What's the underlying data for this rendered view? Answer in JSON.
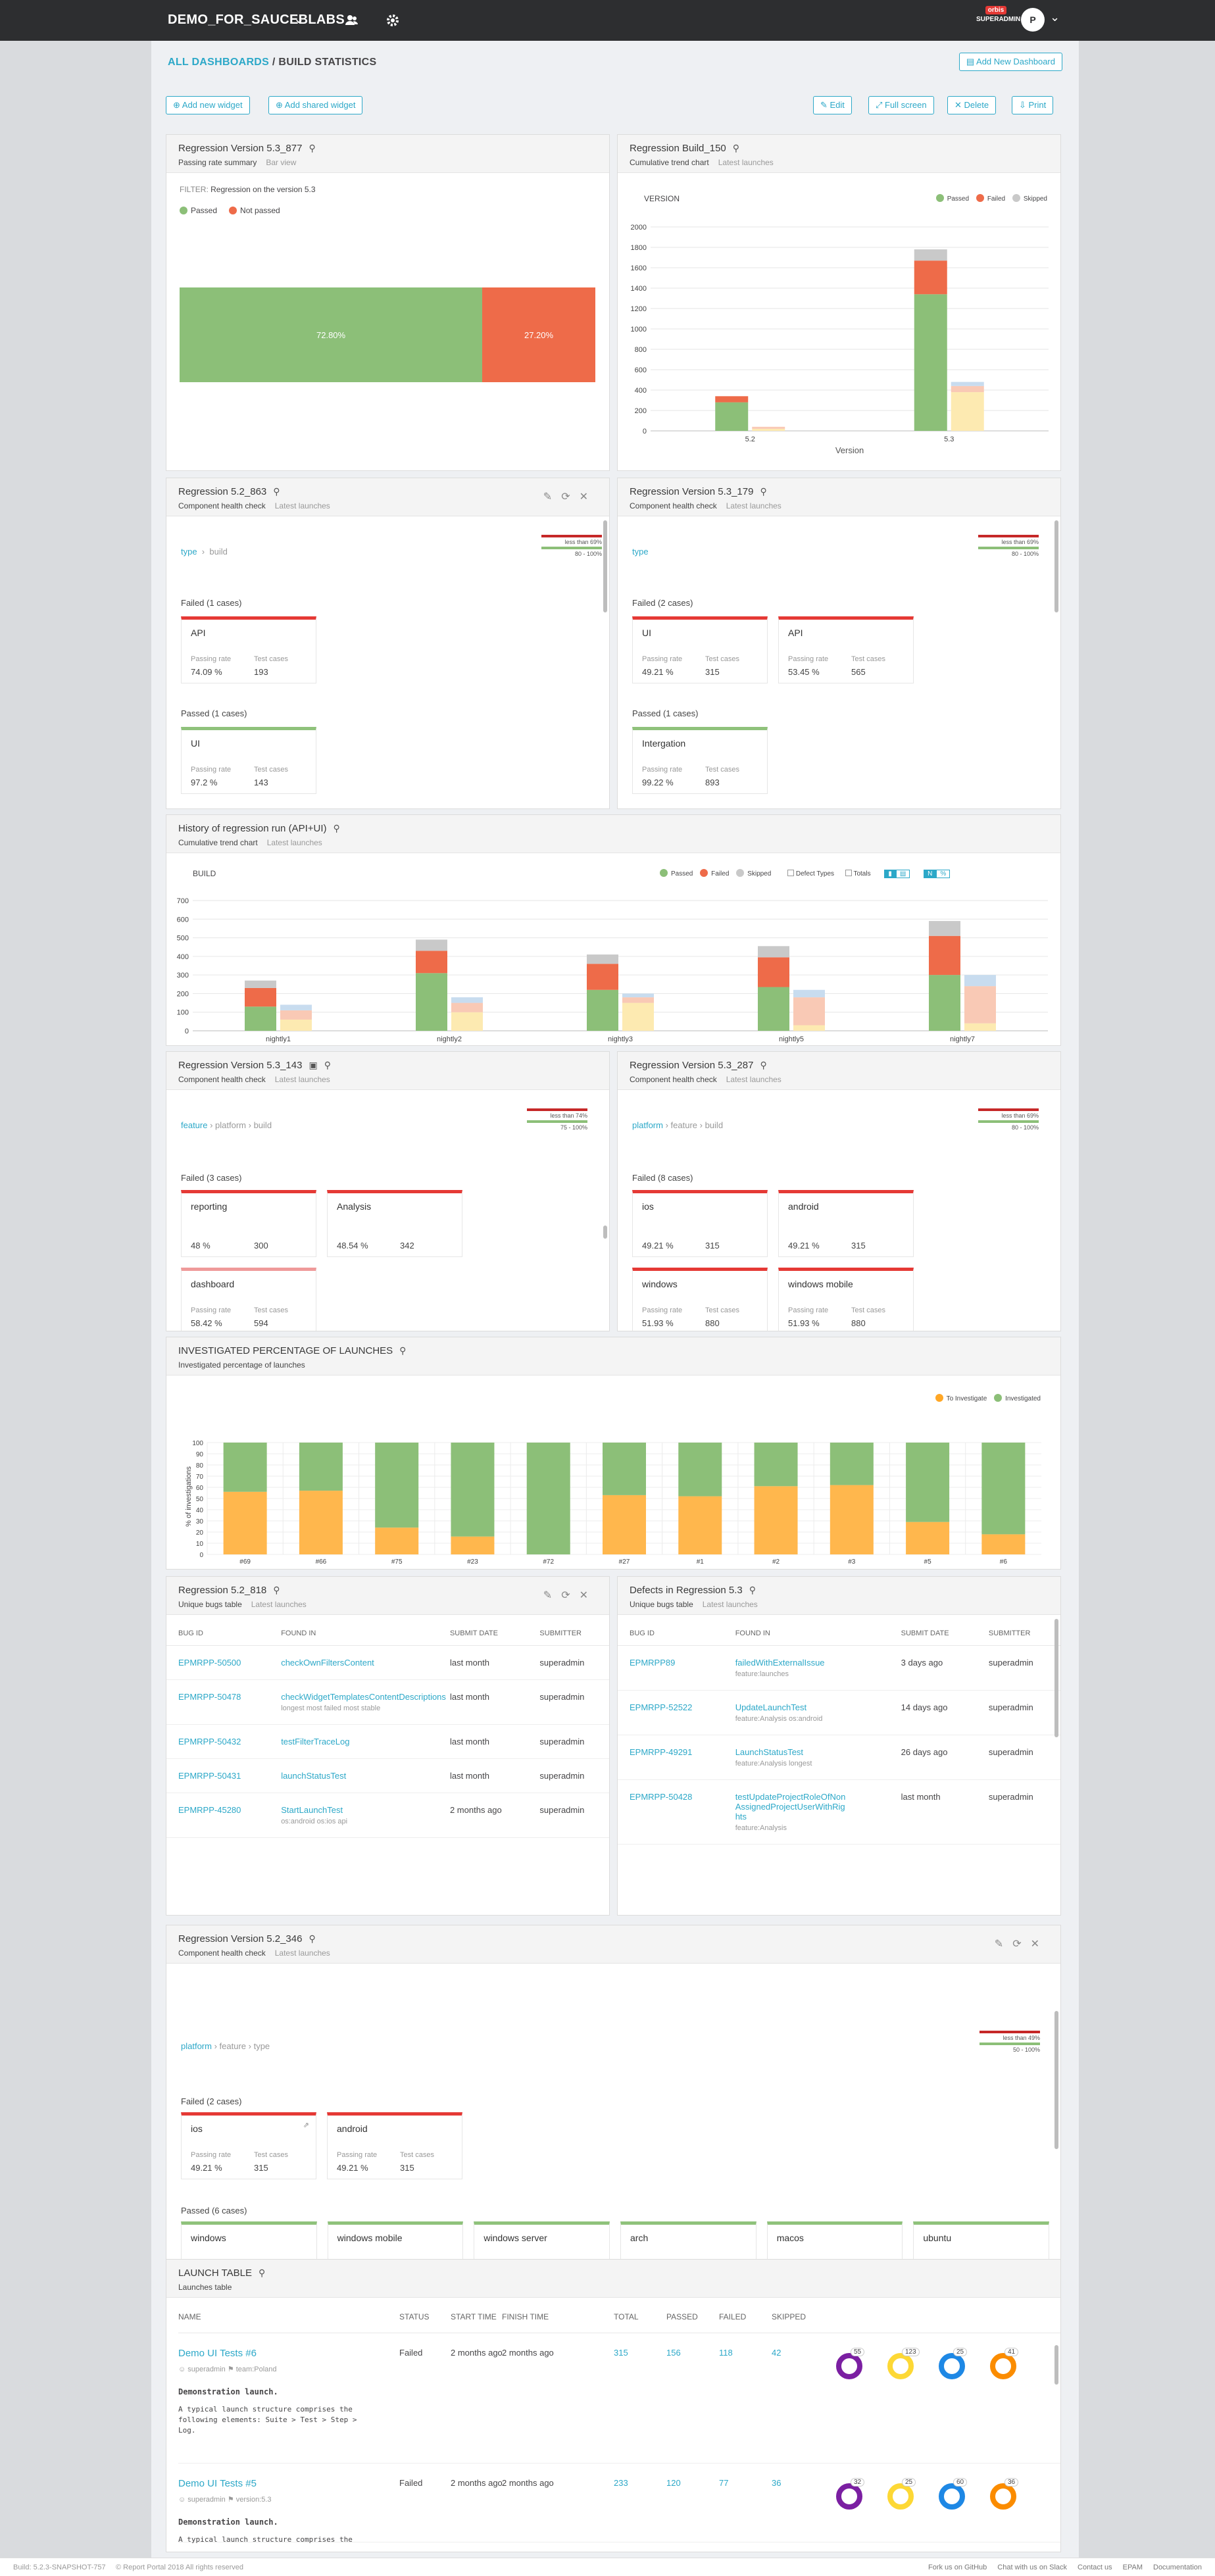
{
  "topbar": {
    "project": "DEMO_FOR_SAUCEBLABS",
    "org_badge": "orbis",
    "org_name": "SUPERADMIN",
    "avatar": "P"
  },
  "breadcrumb": {
    "root": "ALL DASHBOARDS",
    "sep": " / ",
    "current": "BUILD STATISTICS"
  },
  "actions": {
    "add_dashboard": "Add New Dashboard",
    "add_widget": "Add new widget",
    "add_shared": "Add shared widget",
    "edit": "Edit",
    "full_screen": "Full screen",
    "delete": "Delete",
    "print": "Print"
  },
  "w1": {
    "title": "Regression Version 5.3_877",
    "sub": "Passing rate summary",
    "sub2": "Bar view",
    "filter_label": "FILTER:",
    "filter_value": "Regression on the version 5.3",
    "legend": [
      "Passed",
      "Not passed"
    ],
    "passed_pct": "72.80%",
    "not_passed_pct": "27.20%"
  },
  "w2": {
    "title": "Regression Build_150",
    "sub": "Cumulative trend chart",
    "sub2": "Latest launches",
    "label": "VERSION",
    "xlabel": "Version",
    "legend": [
      "Passed",
      "Failed",
      "Skipped"
    ]
  },
  "w3": {
    "title": "Regression 5.2_863",
    "sub": "Component health check",
    "sub2": "Latest launches",
    "crumb": [
      "type",
      "build"
    ],
    "legend_top": "less than 69%",
    "legend_bottom": "80 - 100%",
    "failed_title": "Failed (1 cases)",
    "passed_title": "Passed (1 cases)",
    "metric_a": "Passing rate",
    "metric_b": "Test cases",
    "failed": [
      {
        "name": "API",
        "rate": "74.09 %",
        "cases": "193"
      }
    ],
    "passed": [
      {
        "name": "UI",
        "rate": "97.2 %",
        "cases": "143"
      }
    ]
  },
  "w4": {
    "title": "Regression Version 5.3_179",
    "sub": "Component health check",
    "sub2": "Latest launches",
    "crumb": [
      "type"
    ],
    "legend_top": "less than 69%",
    "legend_bottom": "80 - 100%",
    "failed_title": "Failed (2 cases)",
    "passed_title": "Passed (1 cases)",
    "metric_a": "Passing rate",
    "metric_b": "Test cases",
    "failed": [
      {
        "name": "UI",
        "rate": "49.21 %",
        "cases": "315"
      },
      {
        "name": "API",
        "rate": "53.45 %",
        "cases": "565"
      }
    ],
    "passed": [
      {
        "name": "Intergation",
        "rate": "99.22 %",
        "cases": "893"
      }
    ]
  },
  "w5": {
    "title": "History of regression run (API+UI)",
    "sub": "Cumulative trend chart",
    "sub2": "Latest launches",
    "label": "BUILD",
    "xlabel": "Build",
    "legend": [
      "Passed",
      "Failed",
      "Skipped"
    ],
    "opt1": "Defect Types",
    "opt2": "Totals",
    "toggle_n": "N",
    "toggle_pct": "%"
  },
  "w6": {
    "title": "Regression Version 5.3_143",
    "sub": "Component health check",
    "sub2": "Latest launches",
    "crumb": [
      "feature",
      "platform",
      "build"
    ],
    "legend_top": "less than 74%",
    "legend_bottom": "75 - 100%",
    "failed_title": "Failed (3 cases)",
    "metric_a": "Passing rate",
    "metric_b": "Test cases",
    "failed": [
      {
        "name": "reporting",
        "rate": "48 %",
        "cases": "300"
      },
      {
        "name": "Analysis",
        "rate": "48.54 %",
        "cases": "342"
      },
      {
        "name": "dashboard",
        "rate": "58.42 %",
        "cases": "594"
      }
    ]
  },
  "w7": {
    "title": "Regression Version 5.3_287",
    "sub": "Component health check",
    "sub2": "Latest launches",
    "crumb": [
      "platform",
      "feature",
      "build"
    ],
    "legend_top": "less than 69%",
    "legend_bottom": "80 - 100%",
    "failed_title": "Failed (8 cases)",
    "metric_a": "Passing rate",
    "metric_b": "Test cases",
    "failed": [
      {
        "name": "ios",
        "rate": "49.21 %",
        "cases": "315"
      },
      {
        "name": "android",
        "rate": "49.21 %",
        "cases": "315"
      },
      {
        "name": "windows",
        "rate": "51.93 %",
        "cases": "880"
      },
      {
        "name": "windows mobile",
        "rate": "51.93 %",
        "cases": "880"
      }
    ]
  },
  "w8": {
    "title": "INVESTIGATED PERCENTAGE OF LAUNCHES",
    "sub": "Investigated percentage of launches",
    "legend": [
      "To Investigate",
      "Investigated"
    ],
    "ylabel": "% of investigations"
  },
  "w9": {
    "title": "Regression 5.2_818",
    "sub": "Unique bugs table",
    "sub2": "Latest launches",
    "cols": [
      "BUG ID",
      "FOUND IN",
      "SUBMIT DATE",
      "SUBMITTER"
    ],
    "rows": [
      {
        "id": "EPMRPP-50500",
        "found": "checkOwnFiltersContent",
        "tags": "",
        "date": "last month",
        "by": "superadmin"
      },
      {
        "id": "EPMRPP-50478",
        "found": "checkWidgetTemplatesContentDescriptions",
        "tags": "longest  most failed  most stable",
        "date": "last month",
        "by": "superadmin"
      },
      {
        "id": "EPMRPP-50432",
        "found": "testFilterTraceLog",
        "tags": "",
        "date": "last month",
        "by": "superadmin"
      },
      {
        "id": "EPMRPP-50431",
        "found": "launchStatusTest",
        "tags": "",
        "date": "last month",
        "by": "superadmin"
      },
      {
        "id": "EPMRPP-45280",
        "found": "StartLaunchTest",
        "tags": "os:android  os:ios  api",
        "date": "2 months ago",
        "by": "superadmin"
      }
    ]
  },
  "w10": {
    "title": "Defects in Regression 5.3",
    "sub": "Unique bugs table",
    "sub2": "Latest launches",
    "cols": [
      "BUG ID",
      "FOUND IN",
      "SUBMIT DATE",
      "SUBMITTER"
    ],
    "rows": [
      {
        "id": "EPMRPP89",
        "found": "failedWithExternalIssue",
        "tags": "feature:launches",
        "date": "3 days ago",
        "by": "superadmin"
      },
      {
        "id": "EPMRPP-52522",
        "found": "UpdateLaunchTest",
        "tags": "feature:Analysis  os:android",
        "date": "14 days ago",
        "by": "superadmin"
      },
      {
        "id": "EPMRPP-49291",
        "found": "LaunchStatusTest",
        "tags": "feature:Analysis  longest",
        "date": "26 days ago",
        "by": "superadmin"
      },
      {
        "id": "EPMRPP-50428",
        "found": "testUpdateProjectRoleOfNonAssignedProjectUserWithRights",
        "tags": "feature:Analysis",
        "date": "last month",
        "by": "superadmin"
      }
    ]
  },
  "w11": {
    "title": "Regression Version 5.2_346",
    "sub": "Component health check",
    "sub2": "Latest launches",
    "crumb": [
      "platform",
      "feature",
      "type"
    ],
    "legend_top": "less than 49%",
    "legend_bottom": "50 - 100%",
    "failed_title": "Failed (2 cases)",
    "passed_title": "Passed (6 cases)",
    "metric_a": "Passing rate",
    "metric_b": "Test cases",
    "failed": [
      {
        "name": "ios",
        "rate": "49.21 %",
        "cases": "315"
      },
      {
        "name": "android",
        "rate": "49.21 %",
        "cases": "315"
      }
    ],
    "passed": [
      "windows",
      "windows mobile",
      "windows server",
      "arch",
      "macos",
      "ubuntu"
    ]
  },
  "w12": {
    "title": "LAUNCH TABLE",
    "sub": "Launches table",
    "cols": [
      "NAME",
      "STATUS",
      "START TIME",
      "FINISH TIME",
      "TOTAL",
      "PASSED",
      "FAILED",
      "SKIPPED"
    ],
    "rows": [
      {
        "name": "Demo UI Tests #6",
        "owner": "superadmin",
        "attr": "team:Poland",
        "status": "Failed",
        "start": "2 months ago",
        "finish": "2 months ago",
        "total": "315",
        "passed": "156",
        "failed": "118",
        "skipped": "42",
        "desc_title": "Demonstration launch.",
        "desc": "A typical launch structure comprises the following elements: Suite > Test > Step > Log.",
        "badges": [
          "55",
          "123",
          "25",
          "41"
        ]
      },
      {
        "name": "Demo UI Tests #5",
        "owner": "superadmin",
        "attr": "version:5.3",
        "status": "Failed",
        "start": "2 months ago",
        "finish": "2 months ago",
        "total": "233",
        "passed": "120",
        "failed": "77",
        "skipped": "36",
        "desc_title": "Demonstration launch.",
        "desc": "A typical launch structure comprises the",
        "badges": [
          "32",
          "25",
          "60",
          "36"
        ]
      }
    ]
  },
  "footer": {
    "build": "Build: 5.2.3-SNAPSHOT-757",
    "copy": "© Report Portal 2018 All rights reserved",
    "links": [
      "Fork us on GitHub",
      "Chat with us on Slack",
      "Contact us",
      "EPAM",
      "Documentation"
    ]
  },
  "chart_data": [
    {
      "type": "bar",
      "title": "Regression Version 5.3_877",
      "categories": [
        "Regression on the version 5.3"
      ],
      "series": [
        {
          "name": "Passed",
          "values": [
            72.8
          ]
        },
        {
          "name": "Not passed",
          "values": [
            27.2
          ]
        }
      ]
    },
    {
      "type": "bar",
      "title": "Regression Build_150",
      "xlabel": "Version",
      "categories": [
        "5.2",
        "5.3"
      ],
      "ylim": [
        0,
        2000
      ],
      "yticks": [
        0,
        200,
        400,
        600,
        800,
        1000,
        1200,
        1400,
        1600,
        1800,
        2000
      ],
      "series": [
        {
          "name": "Passed",
          "values": [
            280,
            1340
          ]
        },
        {
          "name": "Failed",
          "values": [
            60,
            330
          ]
        },
        {
          "name": "Skipped",
          "values": [
            0,
            110
          ]
        }
      ],
      "prev_series": [
        {
          "name": "Passed",
          "values": [
            20,
            380
          ]
        },
        {
          "name": "Failed",
          "values": [
            20,
            60
          ]
        },
        {
          "name": "Skipped",
          "values": [
            0,
            40
          ]
        }
      ]
    },
    {
      "type": "bar",
      "title": "History of regression run (API+UI)",
      "xlabel": "Build",
      "categories": [
        "nightly1",
        "nightly2",
        "nightly3",
        "nightly5",
        "nightly7"
      ],
      "ylim": [
        0,
        700
      ],
      "yticks": [
        0,
        100,
        200,
        300,
        400,
        500,
        600,
        700
      ],
      "series": [
        {
          "name": "Passed",
          "values": [
            130,
            310,
            220,
            235,
            300
          ]
        },
        {
          "name": "Failed",
          "values": [
            100,
            120,
            140,
            160,
            210
          ]
        },
        {
          "name": "Skipped",
          "values": [
            40,
            60,
            50,
            60,
            80
          ]
        }
      ],
      "prev_series": [
        {
          "name": "Passed",
          "values": [
            60,
            100,
            150,
            30,
            40
          ]
        },
        {
          "name": "Failed",
          "values": [
            50,
            50,
            30,
            150,
            200
          ]
        },
        {
          "name": "Skipped",
          "values": [
            30,
            30,
            20,
            40,
            60
          ]
        }
      ]
    },
    {
      "type": "bar",
      "title": "INVESTIGATED PERCENTAGE OF LAUNCHES",
      "ylabel": "% of investigations",
      "categories": [
        "#69",
        "#66",
        "#75",
        "#23",
        "#72",
        "#27",
        "#1",
        "#2",
        "#3",
        "#5",
        "#6"
      ],
      "ylim": [
        0,
        100
      ],
      "series": [
        {
          "name": "To Investigate",
          "values": [
            56,
            57,
            24,
            16,
            0,
            53,
            52,
            61,
            62,
            29,
            18
          ]
        },
        {
          "name": "Investigated",
          "values": [
            44,
            43,
            76,
            84,
            100,
            47,
            48,
            39,
            38,
            71,
            82
          ]
        }
      ]
    }
  ]
}
